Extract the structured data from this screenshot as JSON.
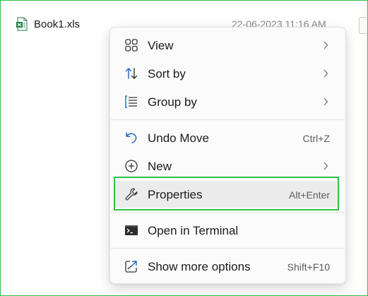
{
  "file": {
    "name": "Book1.xls",
    "date": "22-06-2023 11:16 AM",
    "icon": "excel-file-icon"
  },
  "menu": {
    "items": [
      {
        "label": "View",
        "icon": "view-grid-icon",
        "submenu": true
      },
      {
        "label": "Sort by",
        "icon": "sort-icon",
        "submenu": true
      },
      {
        "label": "Group by",
        "icon": "group-by-icon",
        "submenu": true
      },
      {
        "label": "Undo Move",
        "icon": "undo-icon",
        "shortcut": "Ctrl+Z"
      },
      {
        "label": "New",
        "icon": "new-icon",
        "submenu": true
      },
      {
        "label": "Properties",
        "icon": "wrench-icon",
        "shortcut": "Alt+Enter",
        "highlighted": true
      },
      {
        "label": "Open in Terminal",
        "icon": "terminal-icon"
      },
      {
        "label": "Show more options",
        "icon": "share-more-icon",
        "shortcut": "Shift+F10"
      }
    ]
  },
  "colors": {
    "accent_highlight": "#2fc24a",
    "icon_blue": "#1e66c9",
    "excel_green": "#1d7a43"
  }
}
